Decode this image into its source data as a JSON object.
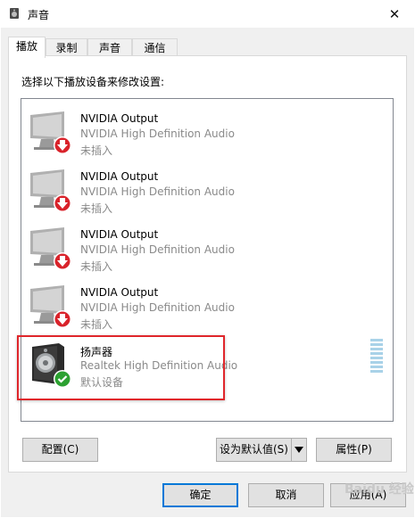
{
  "window": {
    "title": "声音",
    "close_glyph": "✕"
  },
  "tabs": [
    {
      "label": "播放",
      "active": true
    },
    {
      "label": "录制",
      "active": false
    },
    {
      "label": "声音",
      "active": false
    },
    {
      "label": "通信",
      "active": false
    }
  ],
  "instruction": "选择以下播放设备来修改设置:",
  "devices": [
    {
      "name": "NVIDIA Output",
      "driver": "NVIDIA High Definition Audio",
      "status": "未插入",
      "icon": "monitor-icon",
      "badge": "unplugged-arrow-icon"
    },
    {
      "name": "NVIDIA Output",
      "driver": "NVIDIA High Definition Audio",
      "status": "未插入",
      "icon": "monitor-icon",
      "badge": "unplugged-arrow-icon"
    },
    {
      "name": "NVIDIA Output",
      "driver": "NVIDIA High Definition Audio",
      "status": "未插入",
      "icon": "monitor-icon",
      "badge": "unplugged-arrow-icon"
    },
    {
      "name": "NVIDIA Output",
      "driver": "NVIDIA High Definition Audio",
      "status": "未插入",
      "icon": "monitor-icon",
      "badge": "unplugged-arrow-icon"
    },
    {
      "name": "扬声器",
      "driver": "Realtek High Definition Audio",
      "status": "默认设备",
      "icon": "speaker-icon",
      "badge": "default-check-icon"
    }
  ],
  "buttons": {
    "configure": "配置(C)",
    "set_default": "设为默认值(S)",
    "properties": "属性(P)",
    "ok": "确定",
    "cancel": "取消",
    "apply": "应用(A)"
  },
  "watermark": "Baidu 经验",
  "colors": {
    "accent": "#0078d7",
    "highlight": "#e0262b",
    "status_red": "#d9232b",
    "status_green": "#2ca131",
    "meter": "#a9d2e8"
  }
}
